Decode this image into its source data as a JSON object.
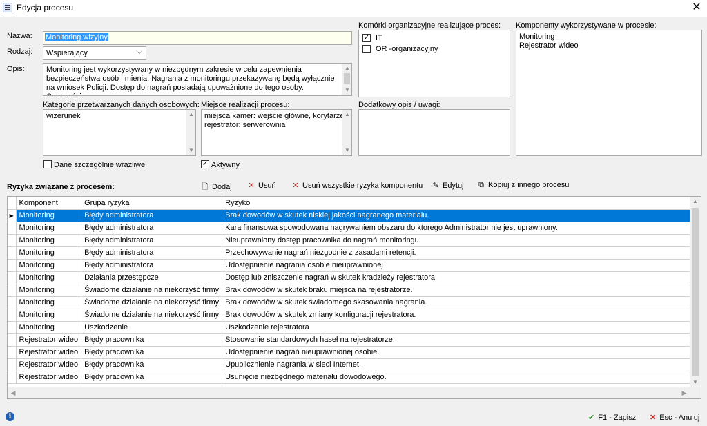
{
  "window": {
    "title": "Edycja procesu",
    "close_glyph": "✕"
  },
  "form": {
    "name_label": "Nazwa:",
    "name_value": "Monitoring wizyjny",
    "type_label": "Rodzaj:",
    "type_value": "Wspierający",
    "description_label": "Opis:",
    "description_value": "Monitoring jest wykorzystywany w niezbędnym zakresie w celu zapewnienia bezpieczeństwa osób i mienia.  Nagrania z monitoringu przekazywanę będą wyłącznie na wniosek Policji. Dostęp do nagrań posiadają upoważnione do tego osoby. Czynności: ",
    "data_categories_label": "Kategorie przetwarzanych danych osobowych:",
    "data_categories_value": "wizerunek",
    "location_label": "Miejsce realizacji procesu:",
    "location_lines": [
      "miejsca kamer: wejście główne, korytarze",
      "rejestrator: serwerownia"
    ],
    "notes_label": "Dodatkowy opis / uwagi:",
    "notes_value": "",
    "sensitive_label": "Dane szczególnie wrażliwe",
    "sensitive_checked": false,
    "active_label": "Aktywny",
    "active_checked": true,
    "org_units_label": "Komórki organizacyjne realizujące proces:",
    "org_units": [
      {
        "label": "IT",
        "checked": true
      },
      {
        "label": "OR -organizacyjny",
        "checked": false
      }
    ],
    "components_label": "Komponenty wykorzystywane w procesie:",
    "components": [
      "Monitoring",
      "Rejestrator wideo"
    ]
  },
  "risks": {
    "section_label": "Ryzyka związane z procesem:",
    "toolbar": {
      "add": "Dodaj",
      "remove": "Usuń",
      "remove_all": "Usuń wszystkie ryzyka komponentu",
      "edit": "Edytuj",
      "copy": "Kopiuj z innego procesu"
    },
    "columns": [
      "Komponent",
      "Grupa ryzyka",
      "Ryzyko"
    ],
    "rows": [
      [
        "Monitoring",
        "Błędy administratora",
        "Brak dowodów w skutek niskiej jakości nagranego materiału."
      ],
      [
        "Monitoring",
        "Błędy administratora",
        "Kara finansowa spowodowana nagrywaniem obszaru do ktorego Administrator nie jest uprawniony."
      ],
      [
        "Monitoring",
        "Błędy administratora",
        "Nieuprawniony dostęp pracownika do nagrań monitoringu"
      ],
      [
        "Monitoring",
        "Błędy administratora",
        "Przechowywanie nagrań niezgodnie z zasadami retencji."
      ],
      [
        "Monitoring",
        "Błędy administratora",
        "Udostępnienie nagrania osobie nieuprawnionej"
      ],
      [
        "Monitoring",
        "Działania przestępcze",
        "Dostęp lub zniszczenie nagrań w skutek kradzieży rejestratora."
      ],
      [
        "Monitoring",
        "Świadome działanie na niekorzyść firmy",
        "Brak dowodów w skutek braku miejsca na rejestratorze."
      ],
      [
        "Monitoring",
        "Świadome działanie na niekorzyść firmy",
        "Brak dowodów w skutek świadomego skasowania nagrania."
      ],
      [
        "Monitoring",
        "Świadome działanie na niekorzyść firmy",
        "Brak dowodów w skutek zmiany konfiguracji rejestratora."
      ],
      [
        "Monitoring",
        "Uszkodzenie",
        "Uszkodzenie rejestratora"
      ],
      [
        "Rejestrator wideo",
        "Błędy pracownika",
        "Stosowanie standardowych haseł na rejestratorze."
      ],
      [
        "Rejestrator wideo",
        "Błędy pracownika",
        "Udostępnienie nagrań nieuprawnionej osobie."
      ],
      [
        "Rejestrator wideo",
        "Błędy pracownika",
        "Upublicznienie nagrania w sieci Internet."
      ],
      [
        "Rejestrator wideo",
        "Błędy pracownika",
        "Usunięcie niezbędnego materiału dowodowego."
      ]
    ],
    "selected_row": 0
  },
  "footer": {
    "save": "F1 - Zapisz",
    "cancel": "Esc - Anuluj"
  },
  "colors": {
    "selection": "#0078d7",
    "name_field_bg": "#fffff0",
    "save_check": "#2e8b2e",
    "cancel_x": "#c62828",
    "info": "#1f5fb4"
  }
}
